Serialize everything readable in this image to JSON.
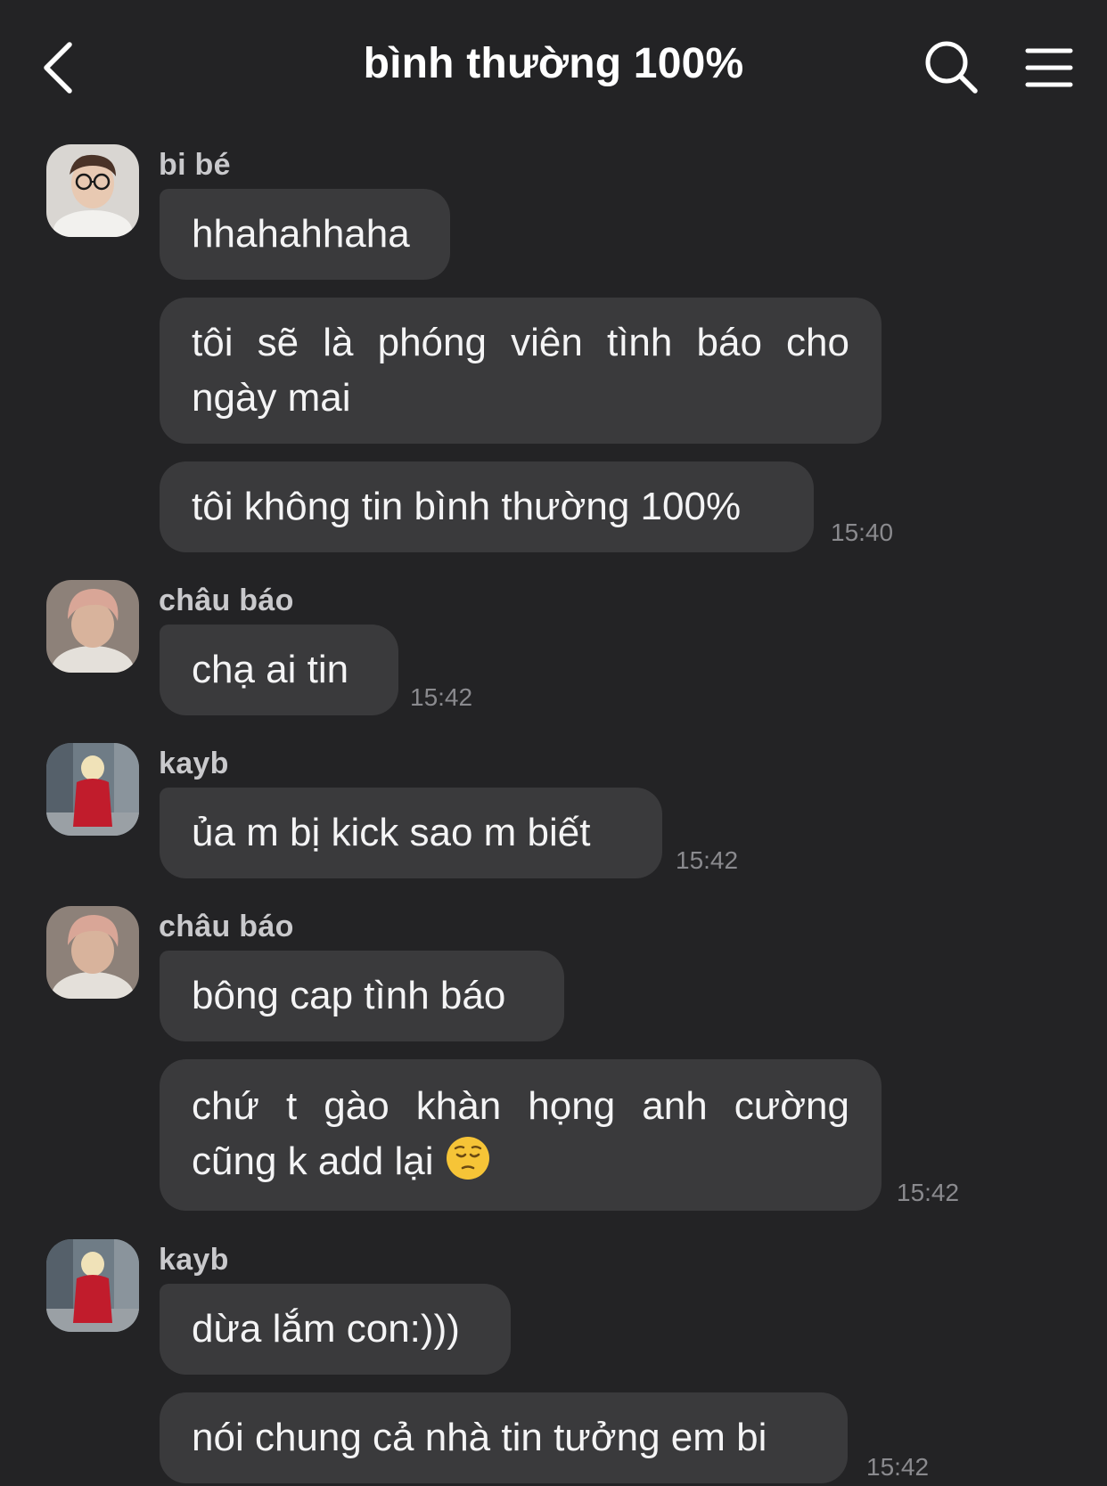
{
  "header": {
    "title": "bình thường 100%",
    "back_icon": "chevron-left-icon",
    "search_icon": "search-icon",
    "menu_icon": "menu-icon"
  },
  "colors": {
    "background": "#232325",
    "bubble": "#3a3a3c",
    "sender_name": "#c9c9cc",
    "timestamp": "#8a8a8e"
  },
  "groups": [
    {
      "sender": "bi bé",
      "avatar": "avatar-photo",
      "messages": [
        {
          "text": "hhahahhaha"
        },
        {
          "text": "tôi sẽ là phóng viên tình báo cho ngày mai"
        },
        {
          "text": "tôi không tin bình thường 100%",
          "time": "15:40"
        }
      ]
    },
    {
      "sender": "châu báo",
      "avatar": "avatar-photo",
      "messages": [
        {
          "text": "chạ ai tin",
          "time": "15:42"
        }
      ]
    },
    {
      "sender": "kayb",
      "avatar": "avatar-photo",
      "messages": [
        {
          "text": "ủa m bị kick sao m biết",
          "time": "15:42"
        }
      ]
    },
    {
      "sender": "châu báo",
      "avatar": "avatar-photo",
      "messages": [
        {
          "text": "bông cap tình báo"
        },
        {
          "text": "chứ t gào khàn họng anh cường cũng k add lại",
          "emoji": "pensive-face-icon",
          "time": "15:42"
        }
      ]
    },
    {
      "sender": "kayb",
      "avatar": "avatar-photo",
      "messages": [
        {
          "text": "dừa lắm con:)))"
        },
        {
          "text": "nói chung cả nhà tin tưởng em bi",
          "time": "15:42"
        }
      ]
    }
  ]
}
